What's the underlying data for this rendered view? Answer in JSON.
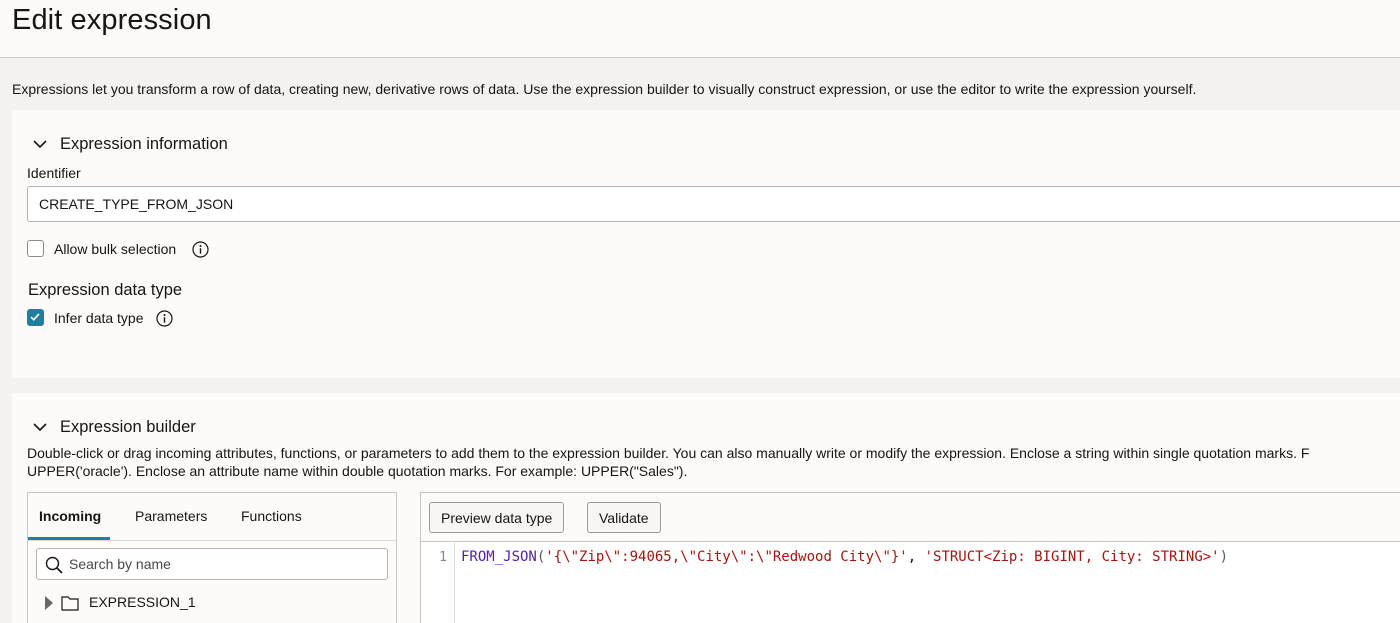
{
  "page": {
    "title": "Edit expression",
    "intro": "Expressions let you transform a row of data, creating new, derivative rows of data. Use the expression builder to visually construct expression, or use the editor to write the expression yourself."
  },
  "expression_info": {
    "section_title": "Expression information",
    "identifier_label": "Identifier",
    "identifier_value": "CREATE_TYPE_FROM_JSON",
    "bulk_selection_label": "Allow bulk selection",
    "bulk_selection_checked": false,
    "data_type_heading": "Expression data type",
    "infer_label": "Infer data type",
    "infer_checked": true
  },
  "builder": {
    "section_title": "Expression builder",
    "help_line1": "Double-click or drag incoming attributes, functions, or parameters to add them to the expression builder. You can also manually write or modify the expression. Enclose a string within single quotation marks. F",
    "help_line2": "UPPER('oracle'). Enclose an attribute name within double quotation marks. For example: UPPER(\"Sales\").",
    "tabs": [
      {
        "label": "Incoming",
        "active": true
      },
      {
        "label": "Parameters",
        "active": false
      },
      {
        "label": "Functions",
        "active": false
      }
    ],
    "search_placeholder": "Search by name",
    "tree_items": [
      {
        "label": "EXPRESSION_1"
      }
    ],
    "buttons": {
      "preview": "Preview data type",
      "validate": "Validate"
    },
    "editor": {
      "line_number": "1",
      "fn_name": "FROM_JSON",
      "open_paren": "(",
      "arg1": "'{\\\"Zip\\\":94065,\\\"City\\\":\\\"Redwood City\\\"}'",
      "separator": ", ",
      "arg2": "'STRUCT<Zip: BIGINT, City: STRING>'",
      "close_paren": ")"
    }
  },
  "colors": {
    "accent": "#227e9e",
    "function_token": "#5521a8",
    "string_token": "#a3160f"
  }
}
